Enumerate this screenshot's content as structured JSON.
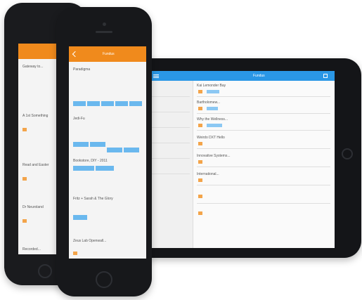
{
  "scene": {
    "description_free": true,
    "colors": {
      "orange": "#f08a1c",
      "blue": "#2a97e6",
      "device": "#141518"
    }
  },
  "phone_front": {
    "title": "Fundus",
    "items": [
      "Paradigma",
      "Jedi-Fu",
      "Bookstore, DIY - 2011",
      "Fritz + Sarah & The Glory",
      "Zeus Lab Openwall..."
    ]
  },
  "phone_back": {
    "items": [
      "Gateway to...",
      "A 1st Something",
      "Read and Easter",
      "Dr Neuroland",
      "Recorded..."
    ]
  },
  "tablet": {
    "title": "Fundus",
    "sidebar": [
      "",
      "",
      "",
      ""
    ],
    "rows": [
      "Kai Lemonder Bay",
      "",
      "Bartholomew...",
      "Why the Wellness...",
      "Weirdo DXT Hello",
      "Innovative Systems...",
      "International...",
      ""
    ]
  }
}
